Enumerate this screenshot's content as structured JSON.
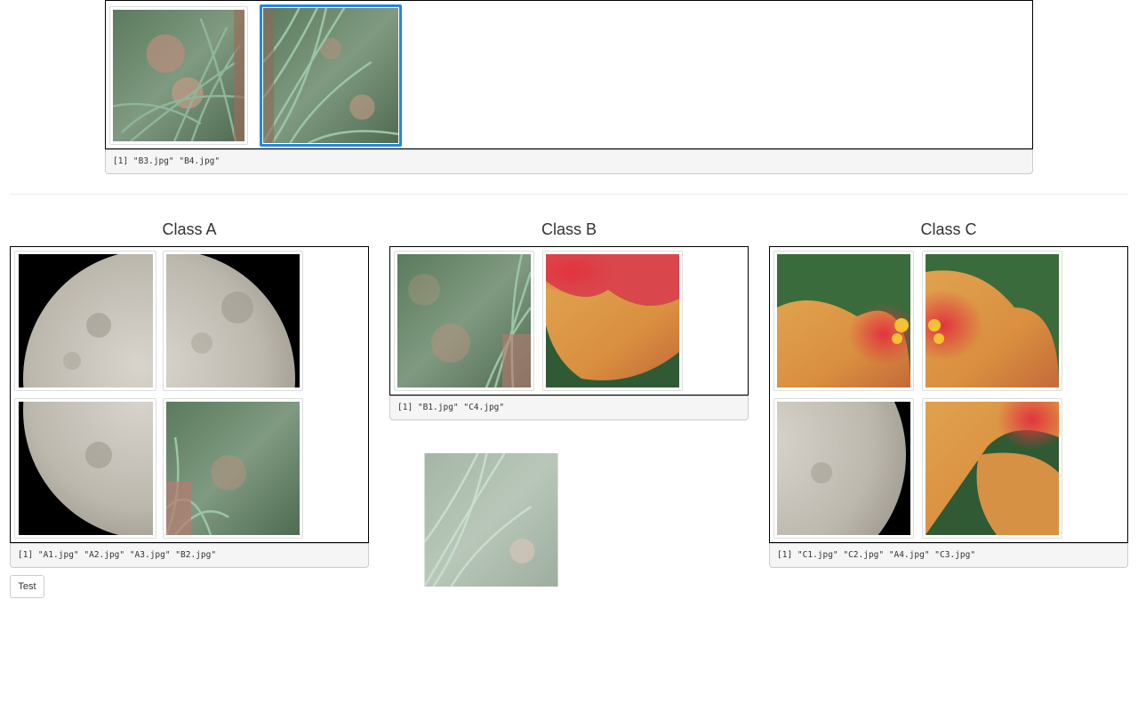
{
  "top": {
    "output": "[1] \"B3.jpg\" \"B4.jpg\""
  },
  "classes": [
    {
      "title": "Class A",
      "output": "[1] \"A1.jpg\" \"A2.jpg\" \"A3.jpg\" \"B2.jpg\""
    },
    {
      "title": "Class B",
      "output": "[1] \"B1.jpg\" \"C4.jpg\""
    },
    {
      "title": "Class C",
      "output": "[1] \"C1.jpg\" \"C2.jpg\" \"A4.jpg\" \"C3.jpg\""
    }
  ],
  "button": {
    "label": "Test"
  },
  "colors": {
    "selected": "#1e88e5"
  }
}
